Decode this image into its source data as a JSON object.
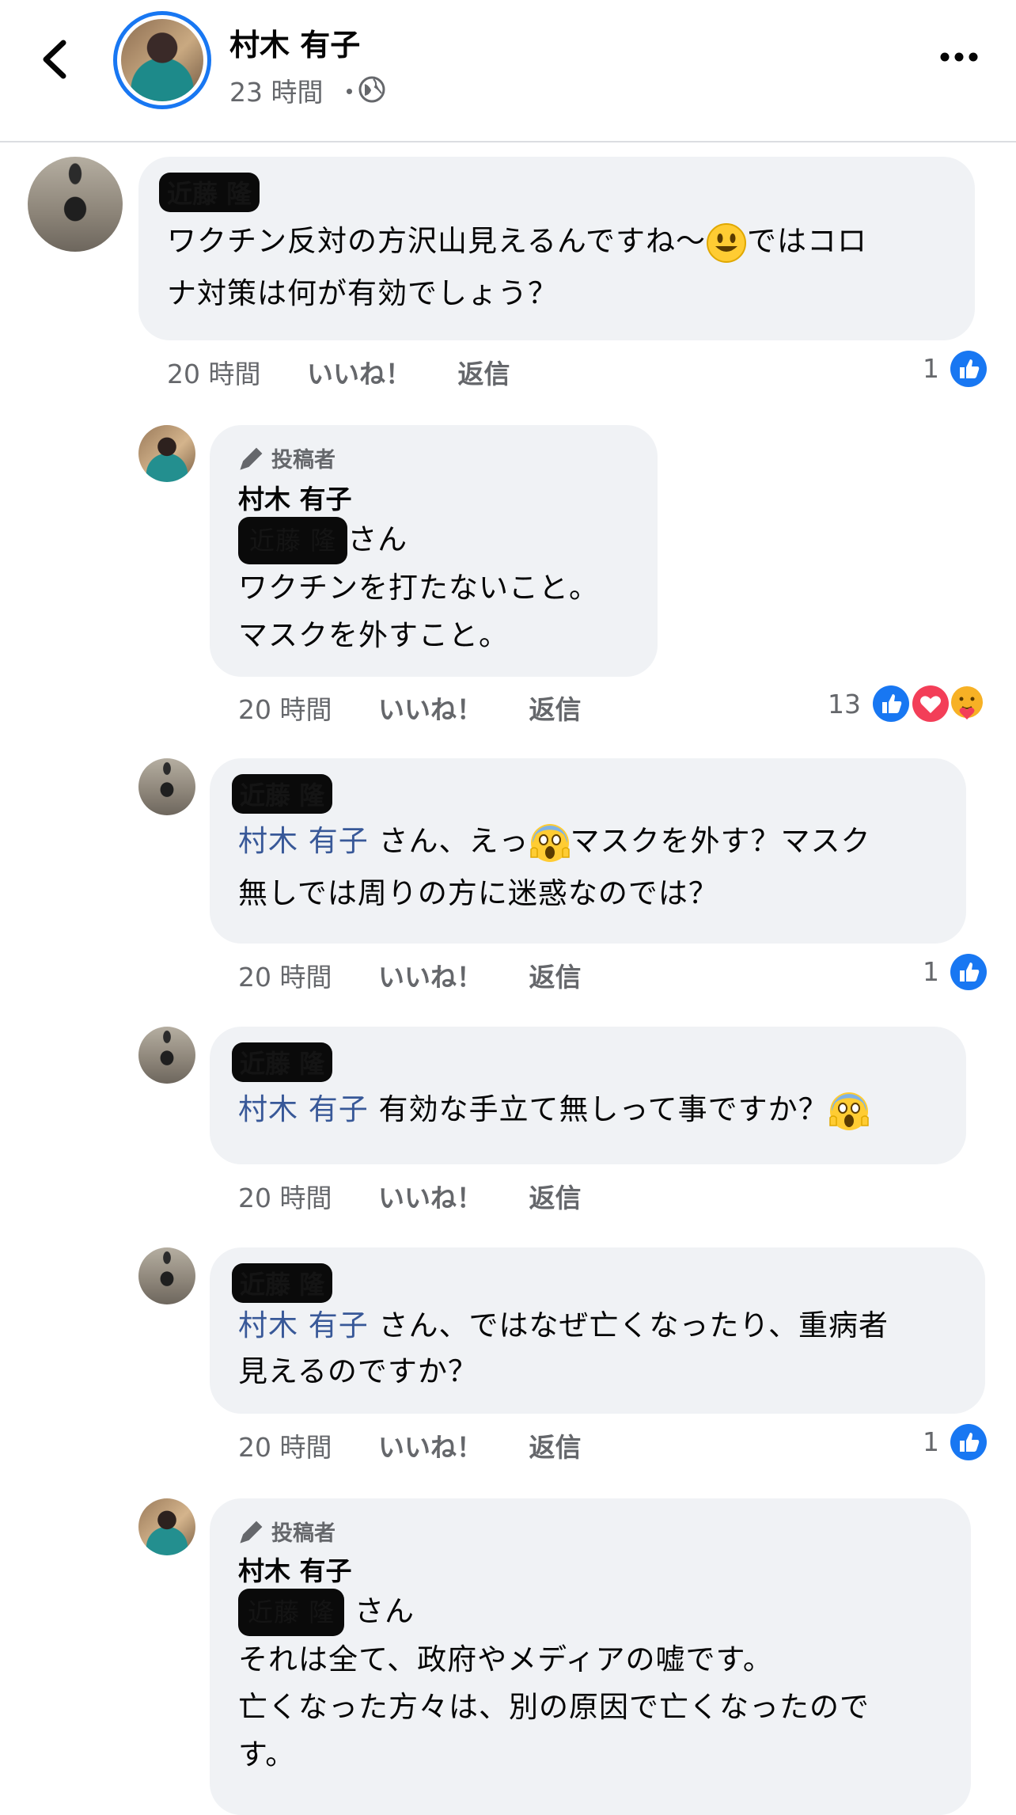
{
  "header": {
    "name": "村木 有子",
    "time": "23 時間",
    "separator": "・"
  },
  "comments": [
    {
      "name": "近藤 隆",
      "text_before_emoji": "ワクチン反対の方沢山見えるんですね〜",
      "text_after_emoji": "ではコロ",
      "text_line2": "ナ対策は何が有効でしょう？",
      "time": "20 時間",
      "like": "いいね！",
      "reply": "返信",
      "reaction_count": "1"
    },
    {
      "badge": "投稿者",
      "author": "村木 有子",
      "redacted_mention": "近藤 隆",
      "line1_suffix": "さん",
      "line2": "ワクチンを打たないこと。",
      "line3": "マスクを外すこと。",
      "time": "20 時間",
      "like": "いいね！",
      "reply": "返信",
      "reaction_count": "13"
    },
    {
      "name": "近藤 隆",
      "mention": "村木 有子",
      "text_a": " さん、えっ",
      "text_b": "マスクを外す？マスク",
      "line2": "無しでは周りの方に迷惑なのでは？",
      "time": "20 時間",
      "like": "いいね！",
      "reply": "返信",
      "reaction_count": "1"
    },
    {
      "name": "近藤 隆",
      "mention": "村木 有子",
      "text": " 有効な手立て無しって事ですか？",
      "time": "20 時間",
      "like": "いいね！",
      "reply": "返信"
    },
    {
      "name": "近藤 隆",
      "mention": "村木 有子",
      "text": " さん、ではなぜ亡くなったり、重病者",
      "line2": "見えるのですか？",
      "time": "20 時間",
      "like": "いいね！",
      "reply": "返信",
      "reaction_count": "1"
    },
    {
      "badge": "投稿者",
      "author": "村木 有子",
      "redacted_mention": "近藤 隆",
      "line1_suffix": " さん",
      "line2": "それは全て、政府やメディアの嘘です。",
      "line3": "亡くなった方々は、別の原因で亡くなったので",
      "line4": "す。"
    }
  ],
  "colors": {
    "accent_blue": "#1877f2",
    "mention": "#385898",
    "bubble": "#f0f2f5",
    "meta_gray": "#65676b",
    "heart_red": "#f33e58"
  }
}
